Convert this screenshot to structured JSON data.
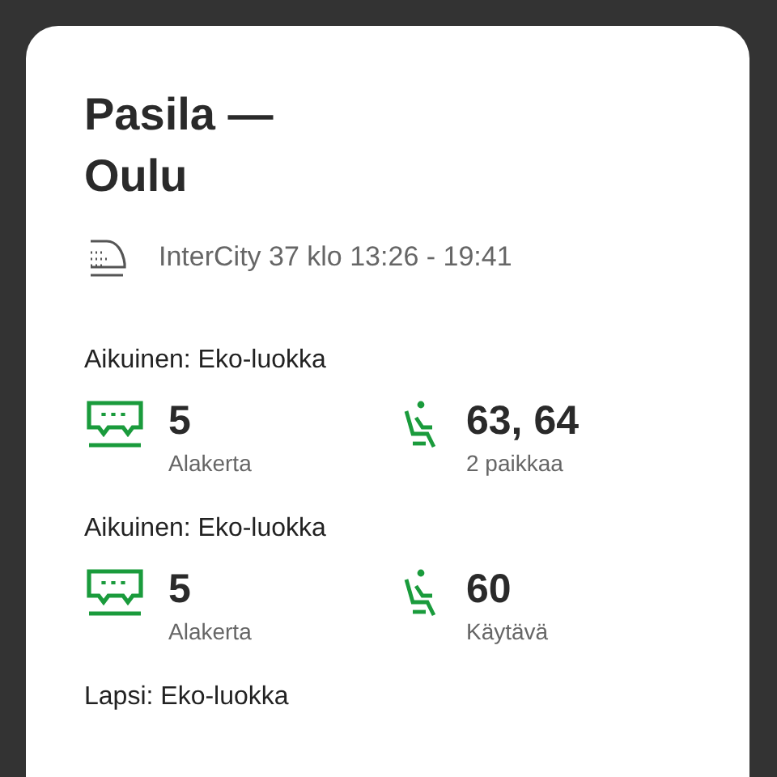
{
  "title_lines": [
    "Pasila —",
    "Oulu"
  ],
  "train": "InterCity 37 klo 13:26 - 19:41",
  "passengers": [
    {
      "heading": "Aikuinen: Eko-luokka",
      "car": "5",
      "car_label": "Alakerta",
      "seat": "63, 64",
      "seat_label": "2 paikkaa"
    },
    {
      "heading": "Aikuinen: Eko-luokka",
      "car": "5",
      "car_label": "Alakerta",
      "seat": "60",
      "seat_label": "Käytävä"
    },
    {
      "heading": "Lapsi: Eko-luokka"
    }
  ]
}
